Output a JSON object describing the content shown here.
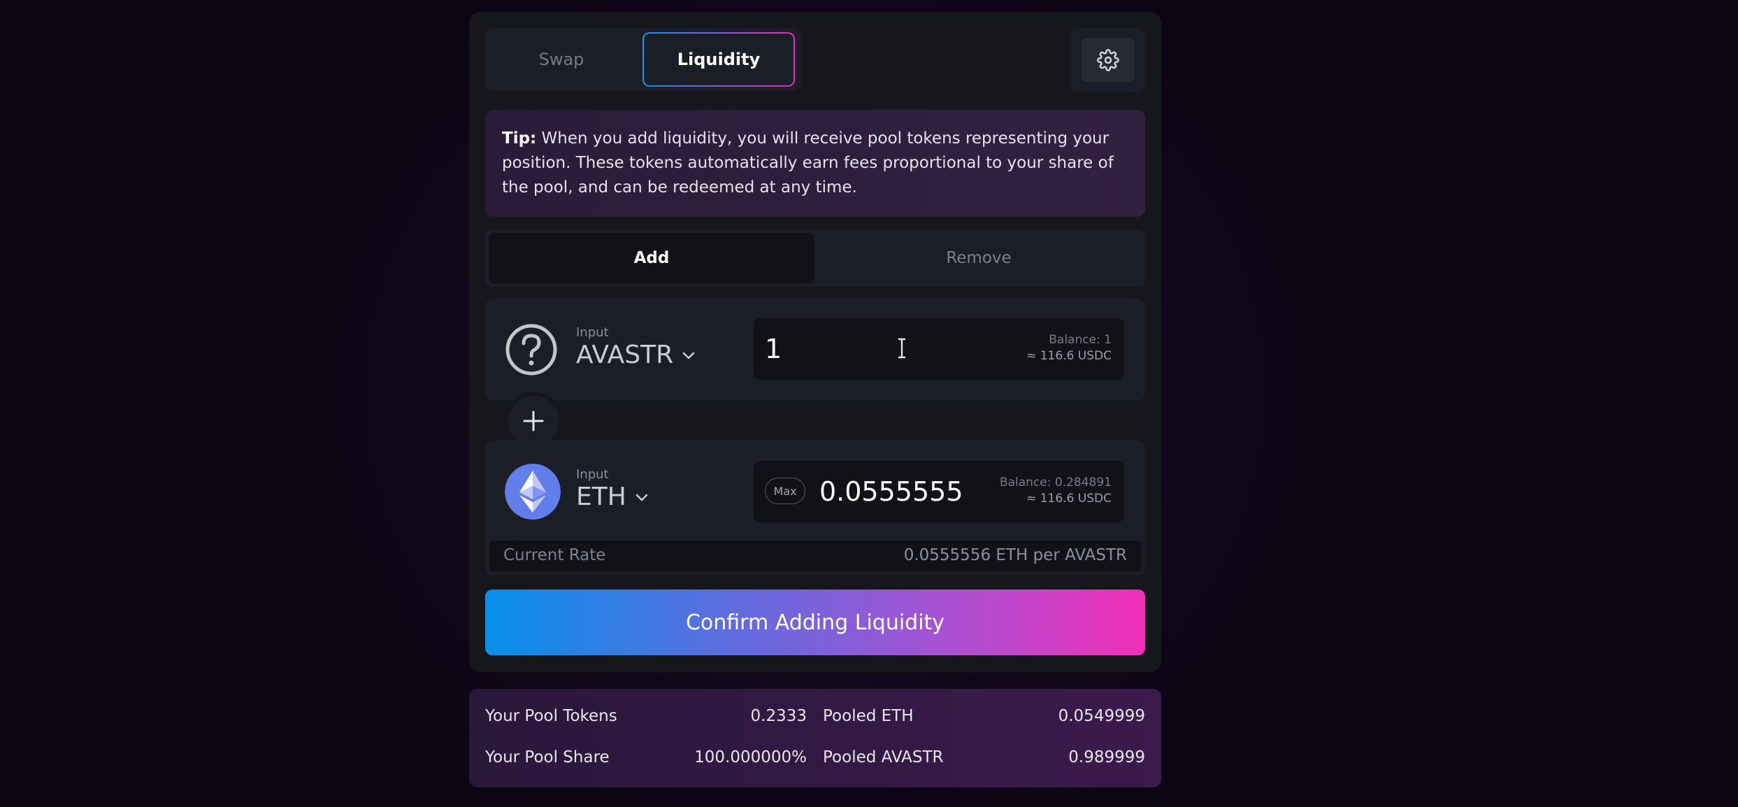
{
  "tabs": {
    "swap": "Swap",
    "liquidity": "Liquidity"
  },
  "tip": {
    "label": "Tip:",
    "text": "When you add liquidity, you will receive pool tokens representing your position. These tokens automatically earn fees proportional to your share of the pool, and can be redeemed at any time."
  },
  "mode": {
    "add": "Add",
    "remove": "Remove"
  },
  "input1": {
    "label": "Input",
    "token": "AVASTR",
    "icon": "question-circle-icon",
    "amount": "1",
    "balance": "Balance: 1",
    "usd": "≈ 116.6 USDC"
  },
  "input2": {
    "label": "Input",
    "token": "ETH",
    "icon": "ethereum-icon",
    "max": "Max",
    "amount": "0.0555555",
    "balance": "Balance: 0.284891",
    "usd": "≈ 116.6 USDC"
  },
  "rate": {
    "label": "Current Rate",
    "value": "0.0555556 ETH per AVASTR"
  },
  "confirm": "Confirm Adding Liquidity",
  "stats": {
    "pool_tokens_label": "Your Pool Tokens",
    "pool_tokens_value": "0.2333",
    "pool_share_label": "Your Pool Share",
    "pool_share_value": "100.000000%",
    "pooled_eth_label": "Pooled ETH",
    "pooled_eth_value": "0.0549999",
    "pooled_avastr_label": "Pooled AVASTR",
    "pooled_avastr_value": "0.989999"
  },
  "colors": {
    "accent_blue": "#0590ea",
    "accent_pink": "#f22fb7",
    "eth_blue": "#627eea"
  }
}
